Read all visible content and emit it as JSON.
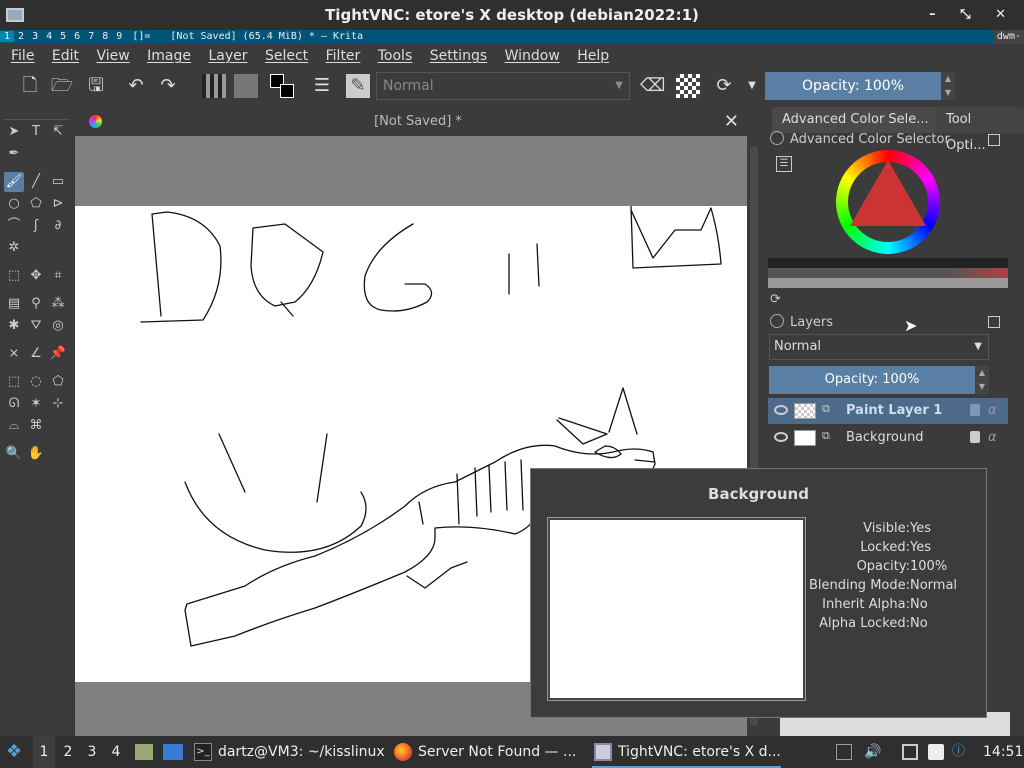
{
  "vnc": {
    "title": "TightVNC: etore's X desktop (debian2022:1)",
    "controls": "– ⤡ ✕"
  },
  "dwm": {
    "tags": [
      "1",
      "2",
      "3",
      "4",
      "5",
      "6",
      "7",
      "8",
      "9"
    ],
    "layout": "[]=",
    "window_info": "[Not Saved]  (65.4 MiB)  * — Krita",
    "right": "dwm-"
  },
  "menu": [
    "File",
    "Edit",
    "View",
    "Image",
    "Layer",
    "Select",
    "Filter",
    "Tools",
    "Settings",
    "Window",
    "Help"
  ],
  "toolbar": {
    "blend_mode": "Normal",
    "opacity": "Opacity: 100%"
  },
  "document": {
    "tab_title": "[Not Saved]  *",
    "close": "✕"
  },
  "dock": {
    "tab_color": "Advanced Color Sele...",
    "tab_tool": "Tool Opti...",
    "color_selector_title": "Advanced Color Selector",
    "layers_title": "Layers",
    "layers_blend": "Normal",
    "layers_opacity": "Opacity:  100%",
    "layers": [
      {
        "name": "Paint Layer 1",
        "alpha": "α"
      },
      {
        "name": "Background",
        "alpha": "α"
      }
    ]
  },
  "tooltip": {
    "title": "Background",
    "props": [
      {
        "k": "Visible:",
        "v": "Yes"
      },
      {
        "k": "Locked:",
        "v": "Yes"
      },
      {
        "k": "Opacity:",
        "v": "100%"
      },
      {
        "k": "Blending Mode:",
        "v": "Normal"
      },
      {
        "k": "Inherit Alpha:",
        "v": "No"
      },
      {
        "k": "Alpha Locked:",
        "v": "No"
      }
    ]
  },
  "taskbar": {
    "workspaces": [
      "1",
      "2",
      "3",
      "4"
    ],
    "tasks": [
      {
        "label": "dartz@VM3: ~/kisslinux"
      },
      {
        "label": "Server Not Found — ..."
      },
      {
        "label": "TightVNC: etore's X d..."
      }
    ],
    "clock": "14:51"
  }
}
